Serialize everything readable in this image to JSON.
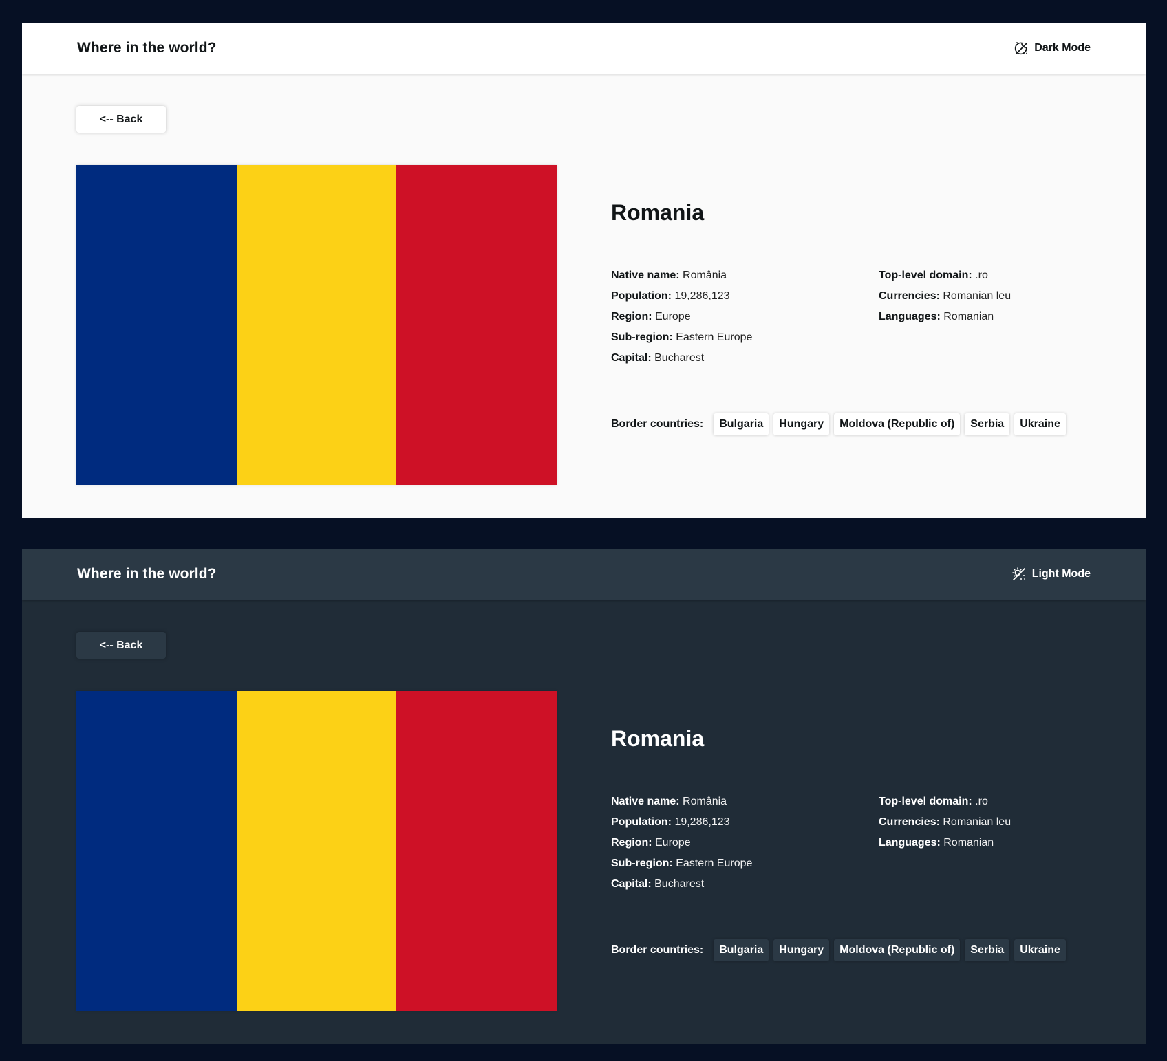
{
  "colors": {
    "page_background": "#061024",
    "light_background": "#fafafa",
    "light_elements": "#ffffff",
    "dark_background": "#202c37",
    "dark_elements": "#2b3945"
  },
  "light": {
    "app_title": "Where in the world?",
    "mode_toggle_label": "Dark Mode",
    "mode_icon": "moon-stars-icon",
    "back_label": "<-- Back",
    "country": {
      "name": "Romania",
      "native_name_label": "Native name:",
      "native_name": "România",
      "population_label": "Population:",
      "population": "19,286,123",
      "region_label": "Region:",
      "region": "Europe",
      "subregion_label": "Sub-region:",
      "subregion": "Eastern Europe",
      "capital_label": "Capital:",
      "capital": "Bucharest",
      "tld_label": "Top-level domain:",
      "tld": ".ro",
      "currencies_label": "Currencies:",
      "currencies": "Romanian leu",
      "languages_label": "Languages:",
      "languages": "Romanian",
      "borders_label": "Border countries:",
      "borders": [
        "Bulgaria",
        "Hungary",
        "Moldova (Republic of)",
        "Serbia",
        "Ukraine"
      ],
      "flag_colors": [
        "#002b7f",
        "#fcd116",
        "#ce1126"
      ]
    }
  },
  "dark": {
    "app_title": "Where in the world?",
    "mode_toggle_label": "Light Mode",
    "mode_icon": "sun-stars-icon",
    "back_label": "<-- Back",
    "country": {
      "name": "Romania",
      "native_name_label": "Native name:",
      "native_name": "România",
      "population_label": "Population:",
      "population": "19,286,123",
      "region_label": "Region:",
      "region": "Europe",
      "subregion_label": "Sub-region:",
      "subregion": "Eastern Europe",
      "capital_label": "Capital:",
      "capital": "Bucharest",
      "tld_label": "Top-level domain:",
      "tld": ".ro",
      "currencies_label": "Currencies:",
      "currencies": "Romanian leu",
      "languages_label": "Languages:",
      "languages": "Romanian",
      "borders_label": "Border countries:",
      "borders": [
        "Bulgaria",
        "Hungary",
        "Moldova (Republic of)",
        "Serbia",
        "Ukraine"
      ],
      "flag_colors": [
        "#002b7f",
        "#fcd116",
        "#ce1126"
      ]
    }
  }
}
